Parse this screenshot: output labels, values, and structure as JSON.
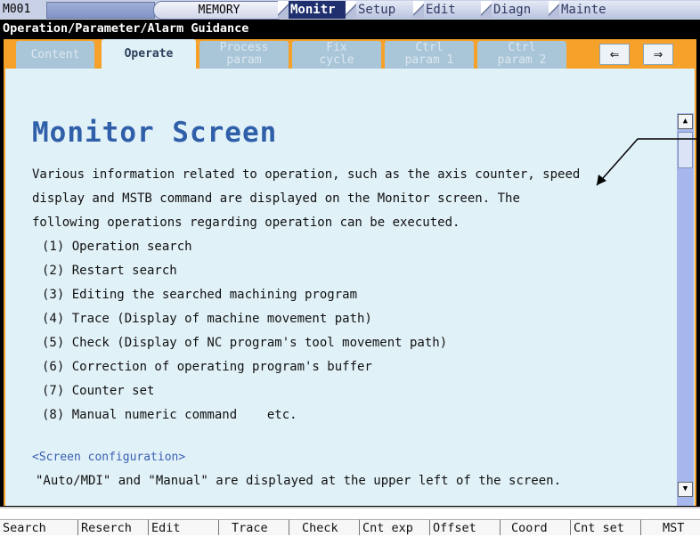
{
  "top_bar": {
    "screen_code": "M001",
    "mode": "MEMORY",
    "menus": [
      "Monitr",
      "Setup",
      "Edit",
      "Diagn",
      "Mainte"
    ],
    "active_menu": "Monitr"
  },
  "window": {
    "title": "Operation/Parameter/Alarm Guidance",
    "tabs": [
      {
        "label": "Content",
        "line2": ""
      },
      {
        "label": "Operate",
        "line2": ""
      },
      {
        "label": "Process",
        "line2": "param"
      },
      {
        "label": "Fix",
        "line2": "cycle"
      },
      {
        "label": "Ctrl",
        "line2": "param 1"
      },
      {
        "label": "Ctrl",
        "line2": "param 2"
      }
    ],
    "active_tab": "Operate",
    "nav_prev": "⇐",
    "nav_next": "⇒"
  },
  "content": {
    "heading": "Monitor Screen",
    "paragraph": [
      "Various information related to operation, such as the axis counter, speed",
      "display and MSTB command are displayed on the Monitor screen. The",
      "following operations regarding operation can be executed."
    ],
    "items": [
      "(1) Operation search",
      "(2) Restart search",
      "(3) Editing the searched machining program",
      "(4) Trace (Display of machine movement path)",
      "(5) Check (Display of NC program's tool movement path)",
      "(6) Correction of operating program's buffer",
      "(7) Counter set",
      "(8) Manual numeric command    etc."
    ],
    "section_link": "<Screen configuration>",
    "section_text": "\"Auto/MDI\" and \"Manual\" are displayed at the upper left of the screen."
  },
  "scrollbar": {
    "up_icon": "▲",
    "down_icon": "▼"
  },
  "function_keys": [
    "Search",
    "Reserch",
    "Edit",
    "Trace",
    "Check",
    "Cnt exp",
    "Offset",
    "Coord",
    "Cnt set",
    "MST"
  ]
}
